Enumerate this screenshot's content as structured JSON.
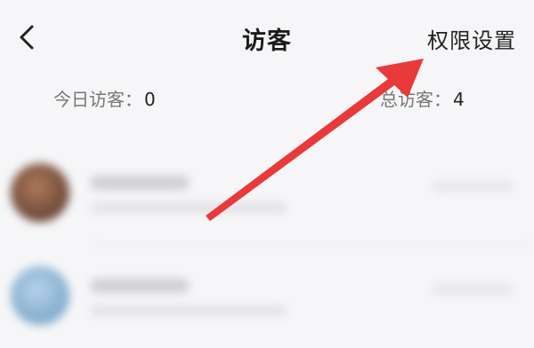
{
  "header": {
    "title": "访客",
    "permission_label": "权限设置"
  },
  "stats": {
    "today_label": "今日访客：",
    "today_value": "0",
    "total_label": "总访客：",
    "total_value": "4"
  },
  "annotation": {
    "arrow_color": "#e83a3a"
  },
  "icons": {
    "back": "chevron-left-icon"
  }
}
